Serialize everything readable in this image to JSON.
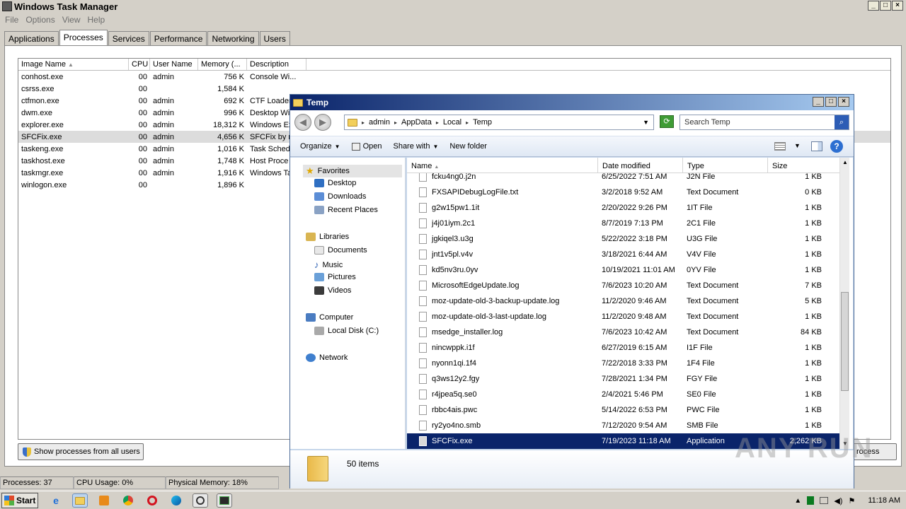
{
  "taskmgr": {
    "title": "Windows Task Manager",
    "menu": [
      "File",
      "Options",
      "View",
      "Help"
    ],
    "tabs": [
      "Applications",
      "Processes",
      "Services",
      "Performance",
      "Networking",
      "Users"
    ],
    "active_tab": "Processes",
    "columns": [
      "Image Name",
      "CPU",
      "User Name",
      "Memory (...",
      "Description"
    ],
    "processes": [
      {
        "name": "conhost.exe",
        "cpu": "00",
        "user": "admin",
        "mem": "756 K",
        "desc": "Console Wi..."
      },
      {
        "name": "csrss.exe",
        "cpu": "00",
        "user": "",
        "mem": "1,584 K",
        "desc": ""
      },
      {
        "name": "ctfmon.exe",
        "cpu": "00",
        "user": "admin",
        "mem": "692 K",
        "desc": "CTF Loader"
      },
      {
        "name": "dwm.exe",
        "cpu": "00",
        "user": "admin",
        "mem": "996 K",
        "desc": "Desktop Wi"
      },
      {
        "name": "explorer.exe",
        "cpu": "00",
        "user": "admin",
        "mem": "18,312 K",
        "desc": "Windows Ex"
      },
      {
        "name": "SFCFix.exe",
        "cpu": "00",
        "user": "admin",
        "mem": "4,656 K",
        "desc": "SFCFix by r"
      },
      {
        "name": "taskeng.exe",
        "cpu": "00",
        "user": "admin",
        "mem": "1,016 K",
        "desc": "Task Sched"
      },
      {
        "name": "taskhost.exe",
        "cpu": "00",
        "user": "admin",
        "mem": "1,748 K",
        "desc": "Host Proce"
      },
      {
        "name": "taskmgr.exe",
        "cpu": "00",
        "user": "admin",
        "mem": "1,916 K",
        "desc": "Windows Ta"
      },
      {
        "name": "winlogon.exe",
        "cpu": "00",
        "user": "",
        "mem": "1,896 K",
        "desc": ""
      }
    ],
    "show_all_label": "Show processes from all users",
    "end_process_label": "rocess",
    "status": {
      "processes": "Processes: 37",
      "cpu": "CPU Usage: 0%",
      "memory": "Physical Memory: 18%"
    }
  },
  "explorer": {
    "title": "Temp",
    "breadcrumb": [
      "admin",
      "AppData",
      "Local",
      "Temp"
    ],
    "search_placeholder": "Search Temp",
    "toolbar": {
      "organize": "Organize",
      "open": "Open",
      "share_with": "Share with",
      "new_folder": "New folder"
    },
    "nav": {
      "favorites": "Favorites",
      "desktop": "Desktop",
      "downloads": "Downloads",
      "recent": "Recent Places",
      "libraries": "Libraries",
      "documents": "Documents",
      "music": "Music",
      "pictures": "Pictures",
      "videos": "Videos",
      "computer": "Computer",
      "local_disk": "Local Disk (C:)",
      "network": "Network"
    },
    "columns": [
      "Name",
      "Date modified",
      "Type",
      "Size"
    ],
    "files": [
      {
        "name": "fcku4ng0.j2n",
        "date": "6/25/2022 7:51 AM",
        "type": "J2N File",
        "size": "1 KB"
      },
      {
        "name": "FXSAPIDebugLogFile.txt",
        "date": "3/2/2018 9:52 AM",
        "type": "Text Document",
        "size": "0 KB"
      },
      {
        "name": "g2w15pw1.1it",
        "date": "2/20/2022 9:26 PM",
        "type": "1IT File",
        "size": "1 KB"
      },
      {
        "name": "j4j01iym.2c1",
        "date": "8/7/2019 7:13 PM",
        "type": "2C1 File",
        "size": "1 KB"
      },
      {
        "name": "jgkiqel3.u3g",
        "date": "5/22/2022 3:18 PM",
        "type": "U3G File",
        "size": "1 KB"
      },
      {
        "name": "jnt1v5pl.v4v",
        "date": "3/18/2021 6:44 AM",
        "type": "V4V File",
        "size": "1 KB"
      },
      {
        "name": "kd5nv3ru.0yv",
        "date": "10/19/2021 11:01 AM",
        "type": "0YV File",
        "size": "1 KB"
      },
      {
        "name": "MicrosoftEdgeUpdate.log",
        "date": "7/6/2023 10:20 AM",
        "type": "Text Document",
        "size": "7 KB"
      },
      {
        "name": "moz-update-old-3-backup-update.log",
        "date": "11/2/2020 9:46 AM",
        "type": "Text Document",
        "size": "5 KB"
      },
      {
        "name": "moz-update-old-3-last-update.log",
        "date": "11/2/2020 9:48 AM",
        "type": "Text Document",
        "size": "1 KB"
      },
      {
        "name": "msedge_installer.log",
        "date": "7/6/2023 10:42 AM",
        "type": "Text Document",
        "size": "84 KB"
      },
      {
        "name": "nincwppk.i1f",
        "date": "6/27/2019 6:15 AM",
        "type": "I1F File",
        "size": "1 KB"
      },
      {
        "name": "nyonn1qi.1f4",
        "date": "7/22/2018 3:33 PM",
        "type": "1F4 File",
        "size": "1 KB"
      },
      {
        "name": "q3ws12y2.fgy",
        "date": "7/28/2021 1:34 PM",
        "type": "FGY File",
        "size": "1 KB"
      },
      {
        "name": "r4jpea5q.se0",
        "date": "2/4/2021 5:46 PM",
        "type": "SE0 File",
        "size": "1 KB"
      },
      {
        "name": "rbbc4ais.pwc",
        "date": "5/14/2022 6:53 PM",
        "type": "PWC File",
        "size": "1 KB"
      },
      {
        "name": "ry2yo4no.smb",
        "date": "7/12/2020 9:54 AM",
        "type": "SMB File",
        "size": "1 KB"
      },
      {
        "name": "SFCFix.exe",
        "date": "7/19/2023 11:18 AM",
        "type": "Application",
        "size": "2,262 KB"
      }
    ],
    "item_count": "50 items"
  },
  "watermark": "ANY RUN",
  "taskbar": {
    "start_label": "Start",
    "clock": "11:18 AM"
  }
}
